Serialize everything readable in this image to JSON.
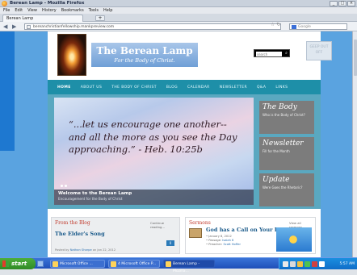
{
  "browser": {
    "title": "Berean Lamp - Mozilla Firefox",
    "menu": [
      "File",
      "Edit",
      "View",
      "History",
      "Bookmarks",
      "Tools",
      "Help"
    ],
    "tab": "Berean Lamp",
    "new_tab": "+",
    "url": "bereanchristianfellowship.mankpreview.com",
    "search_placeholder": "Google"
  },
  "site": {
    "logo_title": "The Berean Lamp",
    "logo_tagline": "For the Body of Christ.",
    "search_placeholder": "search",
    "nav": [
      "HOME",
      "ABOUT US",
      "THE BODY OF CHRIST",
      "BLOG",
      "CALENDAR",
      "NEWSLETTER",
      "Q&A",
      "LINKS"
    ],
    "ghost_text": [
      "GEEP OUT",
      "OFF"
    ],
    "slide": {
      "quote": "“...let us encourage one another-- and all the more as you see the Day approaching.” - Heb. 10:25b",
      "caption_title": "Welcome to the Berean Lamp",
      "caption_sub": "Encouragement for the Body of Christ"
    },
    "sidebar": [
      {
        "title": "The Body",
        "sub": "Who is the Body of Christ?"
      },
      {
        "title": "Newsletter",
        "sub": "Fill for the Month"
      },
      {
        "title": "Update",
        "sub": "Were Goes the Rhetoric?"
      }
    ],
    "blog": {
      "heading": "From the Blog",
      "more": "Continue reading...",
      "post_title": "The Elder's Song",
      "byline_prefix": "Posted by",
      "author": "Nathan Sharpe",
      "date": "on Jan 22, 2012",
      "badge": "0"
    },
    "sermons": {
      "heading": "Sermons",
      "view_all": "View all sermons",
      "title": "God has a Call on Your Life",
      "date": "• January 8, 2012",
      "passage_label": "• Passage:",
      "passage": "Isaiah 6",
      "preacher_label": "• Preacher:",
      "preacher": "Scott Hoffer"
    }
  },
  "taskbar": {
    "start": "start",
    "tasks": [
      "Microsoft Office ...",
      "4 Microsoft Office P...",
      "Berean Lamp - Mozilla..."
    ],
    "time": "5:57 AM"
  },
  "colors": {
    "nav": "#1e8fa8",
    "page_bg": "#5aa3e0",
    "heading_red": "#c0392b"
  }
}
